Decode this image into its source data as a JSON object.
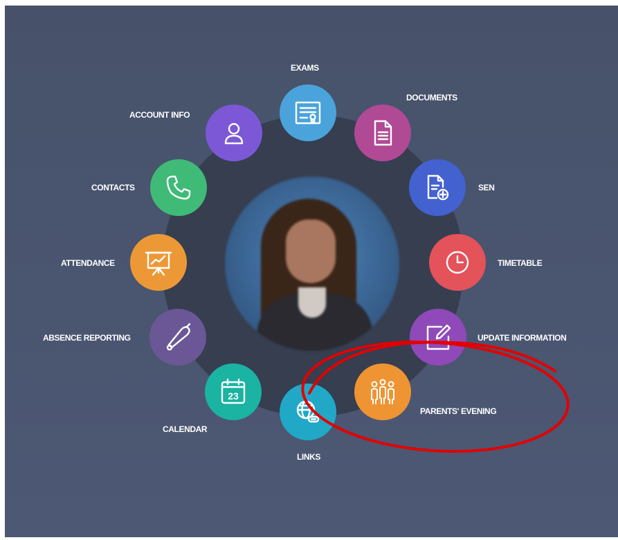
{
  "menu": {
    "exams": {
      "label": "EXAMS",
      "color": "#4aa3db",
      "icon": "certificate-icon"
    },
    "documents": {
      "label": "DOCUMENTS",
      "color": "#b04a94",
      "icon": "document-icon"
    },
    "sen": {
      "label": "SEN",
      "color": "#4361cf",
      "icon": "document-add-icon"
    },
    "timetable": {
      "label": "TIMETABLE",
      "color": "#e4525a",
      "icon": "clock-icon"
    },
    "update_information": {
      "label": "UPDATE INFORMATION",
      "color": "#8f49b8",
      "icon": "edit-icon"
    },
    "parents_evening": {
      "label": "PARENTS' EVENING",
      "color": "#ee9432",
      "icon": "people-icon"
    },
    "links": {
      "label": "LINKS",
      "color": "#21a8c7",
      "icon": "globe-link-icon"
    },
    "calendar": {
      "label": "CALENDAR",
      "color": "#1bb3a1",
      "icon": "calendar-icon",
      "day": "23"
    },
    "absence_reporting": {
      "label": "ABSENCE REPORTING",
      "color": "#6b5796",
      "icon": "bell-icon"
    },
    "attendance": {
      "label": "ATTENDANCE",
      "color": "#ed9836",
      "icon": "presentation-chart-icon"
    },
    "contacts": {
      "label": "CONTACTS",
      "color": "#3fba77",
      "icon": "phone-icon"
    },
    "account_info": {
      "label": "ACCOUNT INFO",
      "color": "#7c58d6",
      "icon": "user-icon"
    }
  },
  "annotation": {
    "color": "#e30000"
  }
}
